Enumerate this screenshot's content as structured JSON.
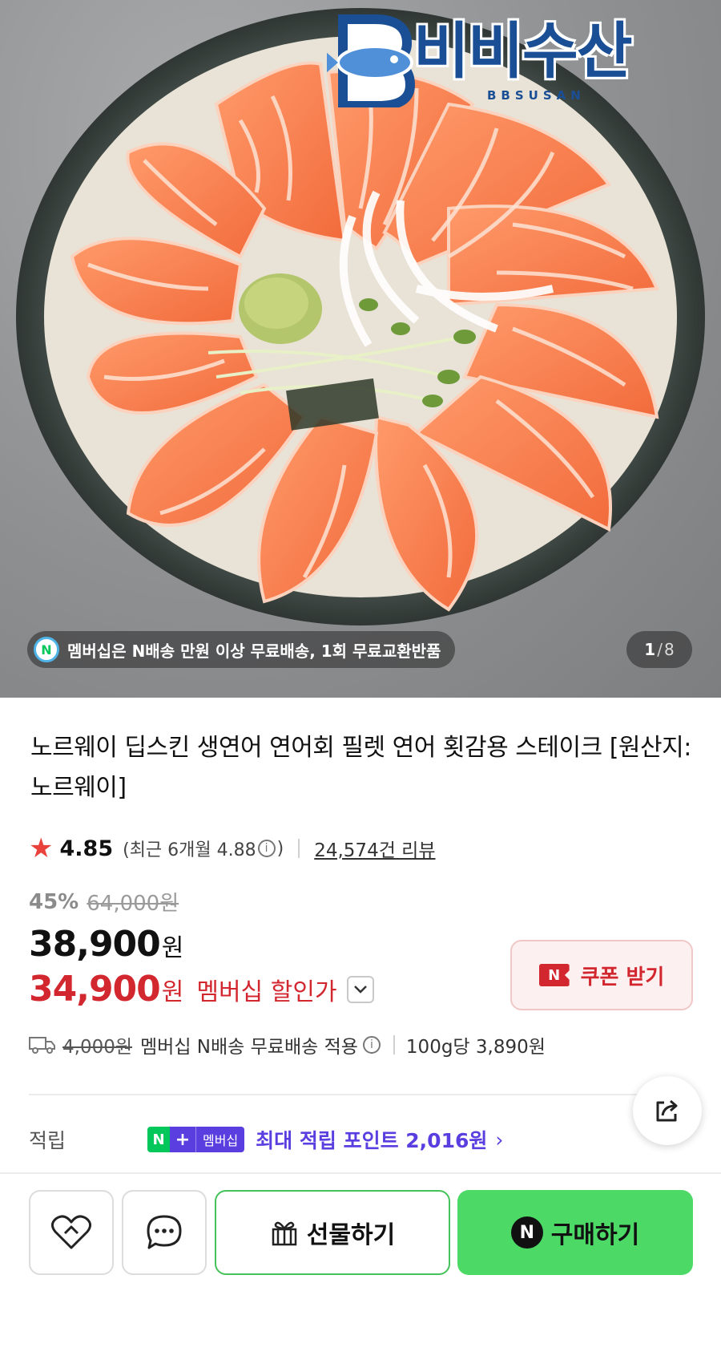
{
  "hero": {
    "brand": {
      "name": "비비수산",
      "sub": "BBSUSAN"
    },
    "membership_banner": {
      "badge": "N",
      "text": "멤버십은 N배송 만원 이상 무료배송, 1회 무료교환반품"
    },
    "page_counter": {
      "current": "1",
      "separator": "/",
      "total": "8"
    }
  },
  "product": {
    "title": "노르웨이 딥스킨 생연어 연어회 필렛 연어 횟감용 스테이크 [원산지:노르웨이]",
    "rating": {
      "star": "★",
      "score": "4.85",
      "recent_prefix": "(최근 6개월 4.88",
      "recent_suffix": ")",
      "info": "i",
      "review_count": "24,574건 리뷰"
    },
    "price": {
      "discount_rate": "45%",
      "original": "64,000원",
      "sale": "38,900",
      "currency": "원",
      "member_price": "34,900",
      "member_label": "멤버십 할인가",
      "chevron": "⌄"
    },
    "coupon": {
      "icon": "N",
      "label": "쿠폰 받기"
    },
    "shipping": {
      "fee_strike": "4,000원",
      "text": "멤버십 N배송 무료배송 적용",
      "info": "i",
      "unit_price": "100g당 3,890원"
    },
    "points": {
      "label": "적립",
      "badge_n": "N",
      "badge_plus": "+",
      "badge_member": "멤버십",
      "text": "최대 적립 포인트 2,016원",
      "chevron": "›"
    }
  },
  "actions": {
    "gift_label": "선물하기",
    "buy_badge": "N",
    "buy_label": "구매하기"
  },
  "colors": {
    "accent_red": "#d3272f",
    "naver_green": "#03c75a",
    "buy_green": "#4cd966",
    "member_purple": "#5a3ee0",
    "star": "#e8423a"
  }
}
